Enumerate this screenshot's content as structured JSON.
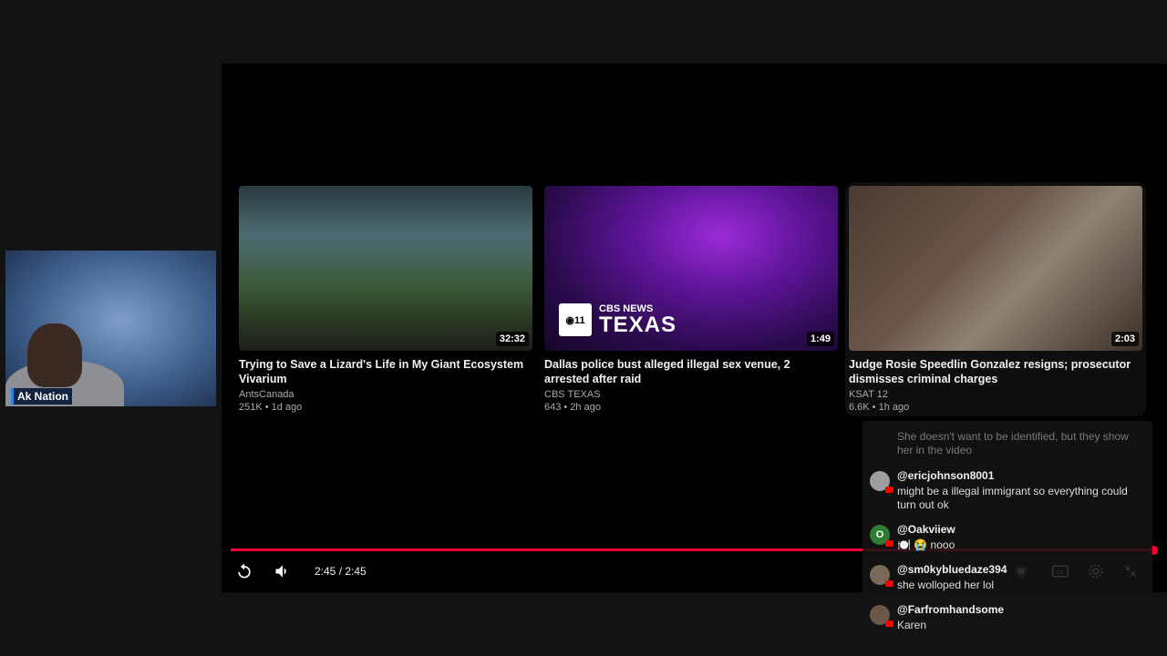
{
  "webcam": {
    "name": "Ak Nation"
  },
  "end_screen": {
    "cards": [
      {
        "title": "Trying to Save a Lizard's Life in My Giant Ecosystem Vivarium",
        "channel": "AntsCanada",
        "meta": "251K • 1d ago",
        "duration": "32:32"
      },
      {
        "title": "Dallas police bust alleged illegal sex venue, 2 arrested after raid",
        "channel": "CBS TEXAS",
        "meta": "643 • 2h ago",
        "duration": "1:49",
        "logo_top": "CBS NEWS",
        "logo_bottom": "TEXAS"
      },
      {
        "title": "Judge Rosie Speedlin Gonzalez resigns; prosecutor dismisses criminal charges",
        "channel": "KSAT 12",
        "meta": "6.6K • 1h ago",
        "duration": "2:03"
      }
    ]
  },
  "controls": {
    "time": "2:45 / 2:45",
    "progress": 1.0,
    "icons": [
      "replay-icon",
      "volume-icon",
      "pause-icon",
      "cc-icon",
      "settings-icon",
      "exit-fullscreen-icon"
    ]
  },
  "chat": {
    "messages": [
      {
        "user": "",
        "text": "She doesn't want to be identified, but they show her in the video",
        "faded": true
      },
      {
        "user": "@ericjohnson8001",
        "text": "might be a illegal immigrant so everything could turn out ok"
      },
      {
        "user": "@Oakviiew",
        "text": "🍽️ 😭 nooo",
        "initial": "O"
      },
      {
        "user": "@sm0kybluedaze394",
        "text": "she wolloped her lol"
      },
      {
        "user": "@Farfromhandsome",
        "text": "Karen"
      }
    ]
  },
  "colors": {
    "accent": "#ff0033",
    "background": "#000000",
    "name_tag": "#122340"
  }
}
